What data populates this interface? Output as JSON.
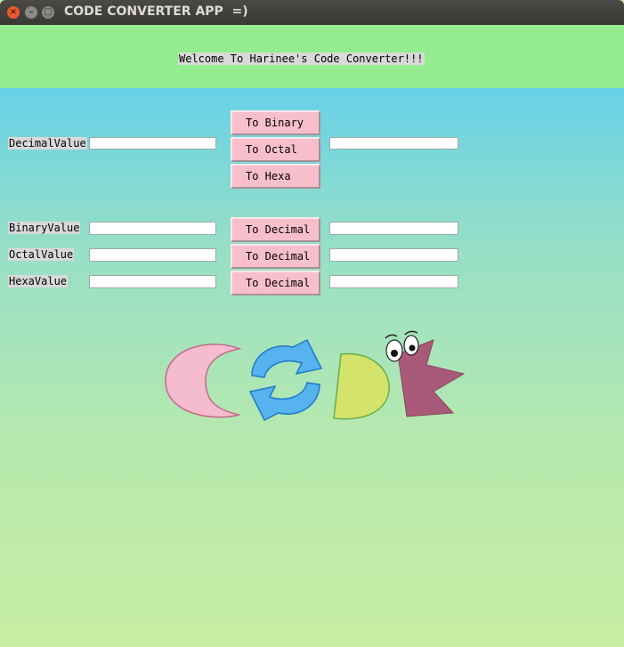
{
  "window": {
    "title": "CODE CONVERTER APP  =)",
    "controls": {
      "close": "×",
      "minimize": "–",
      "maximize": "□"
    }
  },
  "header": {
    "welcome": "Welcome To Harinee's Code Converter!!!"
  },
  "decimal_section": {
    "label": "DecimalValue",
    "input_value": "",
    "output_value": "",
    "buttons": [
      "To Binary",
      "To Octal",
      "To Hexa"
    ]
  },
  "reverse_section": {
    "rows": [
      {
        "label": "BinaryValue",
        "input_value": "",
        "button": "To Decimal",
        "output_value": ""
      },
      {
        "label": "OctalValue",
        "input_value": "",
        "button": "To Decimal",
        "output_value": ""
      },
      {
        "label": "HexaValue",
        "input_value": "",
        "button": "To Decimal",
        "output_value": ""
      }
    ]
  },
  "colors": {
    "header_bg": "#93ec8d",
    "button_bg": "#f7bfcb",
    "logo_c": "#f5bcd0",
    "logo_d": "#d4e36b",
    "logo_e": "#a85a78",
    "logo_arrows": "#57b3f0"
  },
  "logo": {
    "icons": [
      "c-shape-icon",
      "refresh-arrows-icon",
      "d-shape-icon",
      "e-creature-icon"
    ]
  }
}
